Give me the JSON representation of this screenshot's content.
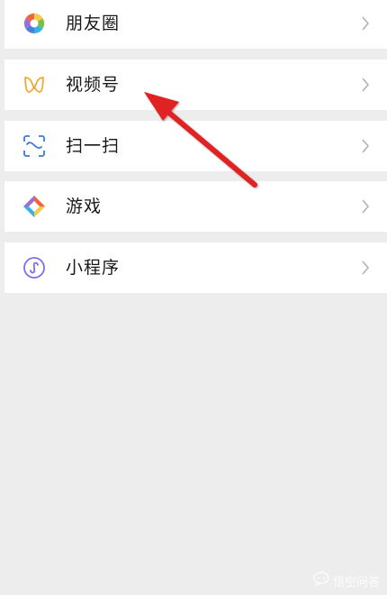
{
  "menu": {
    "items": [
      {
        "id": "moments",
        "label": "朋友圈"
      },
      {
        "id": "channels",
        "label": "视频号"
      },
      {
        "id": "scan",
        "label": "扫一扫"
      },
      {
        "id": "games",
        "label": "游戏"
      },
      {
        "id": "mini_programs",
        "label": "小程序"
      }
    ]
  },
  "watermark": {
    "text": "悟空问答"
  },
  "colors": {
    "background": "#ededed",
    "row": "#ffffff",
    "chevron": "#b2b2b2",
    "arrow": "#e02020",
    "channels_icon": "#f2a93b",
    "mini_program_icon": "#7d6ee8",
    "scan_icon": "#3a7bd5"
  }
}
